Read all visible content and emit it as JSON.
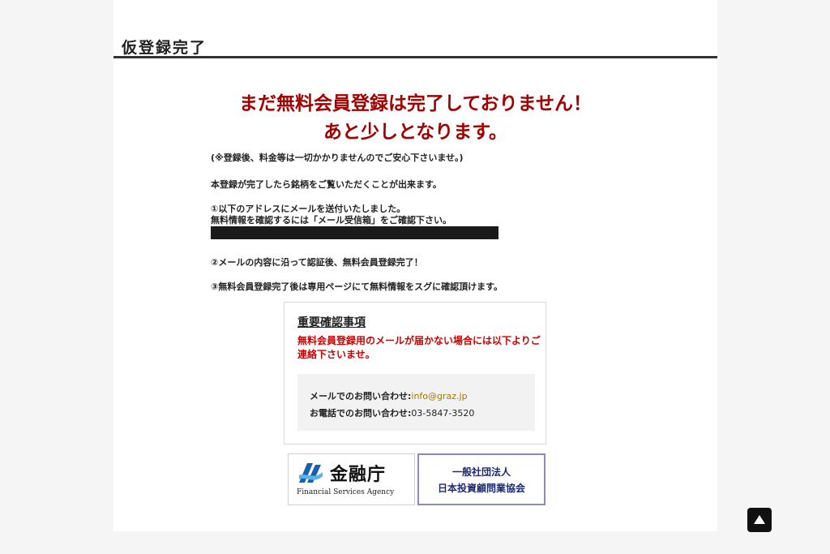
{
  "page": {
    "title": "仮登録完了"
  },
  "headline": {
    "line1": "まだ無料会員登録は完了しておりません！",
    "line2": "あと少しとなります。"
  },
  "body": {
    "note_free": "(※登録後、料金等は一切かかりませんのでご安心下さいませ。)",
    "note_after": "本登録が完了したら銘柄をご覧いただくことが出来ます。",
    "step1_line1": "①以下のアドレスにメールを送付いたしました。",
    "step1_line2": "無料情報を確認するには「メール受信箱」をご確認下さい。",
    "step2": "②メールの内容に沿って認証後、無料会員登録完了！",
    "step3": "③無料会員登録完了後は専用ページにて無料情報をスグに確認頂けます。"
  },
  "notice": {
    "title": "重要確認事項",
    "warning": "無料会員登録用のメールが届かない場合には以下よりご連絡下さいませ。",
    "email_label": "メールでのお問い合わせ:",
    "email_value": "info@graz.jp",
    "phone_label": "お電話でのお問い合わせ:",
    "phone_value": "03-5847-3520"
  },
  "banners": {
    "fsa_name": "金融庁",
    "fsa_english": "Financial Services Agency",
    "jiaa_line1": "一般社団法人",
    "jiaa_line2": "日本投資顧問業協会"
  },
  "colors": {
    "headline": "#a00000",
    "warning": "#cc0000",
    "email": "#a07800"
  },
  "icons": {
    "back_to_top": "triangle-up-icon",
    "fsa_logo": "fsa-logo-icon"
  }
}
